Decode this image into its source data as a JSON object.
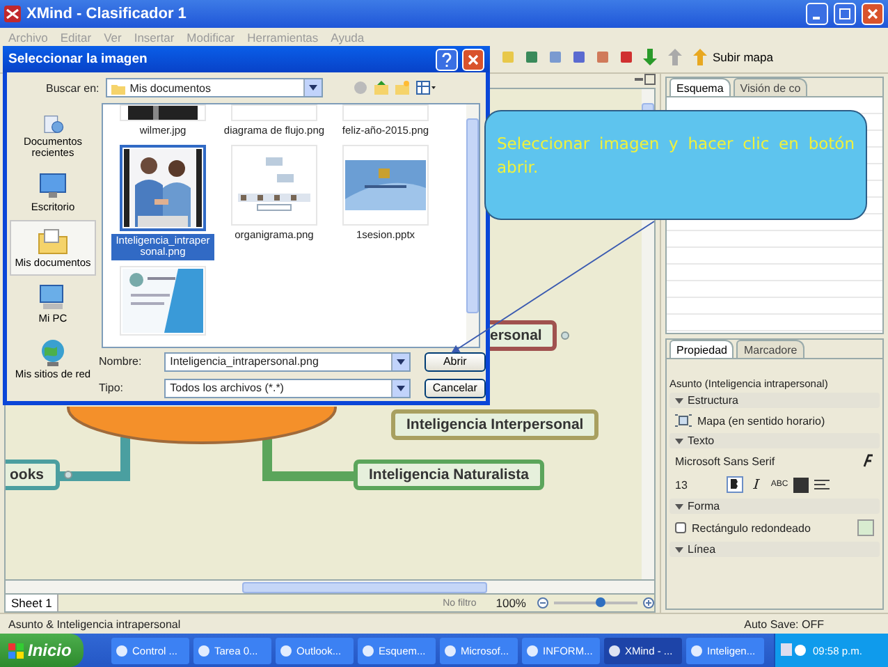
{
  "window": {
    "title": "XMind - Clasificador 1"
  },
  "menu": [
    "Archivo",
    "Editar",
    "Ver",
    "Insertar",
    "Modificar",
    "Herramientas",
    "Ayuda"
  ],
  "toolbar": {
    "button": "Subir mapa"
  },
  "map": {
    "nodes": [
      {
        "label": "ersonal",
        "kind": "topic",
        "color": "#a0524f"
      },
      {
        "label": "Inteligencia Interpersonal",
        "kind": "topic",
        "color": "#a8a060"
      },
      {
        "label": "ooks",
        "kind": "topic",
        "color": "#4a9fa0"
      },
      {
        "label": "Inteligencia Naturalista",
        "kind": "topic",
        "color": "#5ba55b"
      }
    ]
  },
  "editor_status": {
    "sheet": "Sheet 1",
    "filter": "No filtro",
    "zoom": "100%",
    "zoom_slider": {
      "level": 0.55
    }
  },
  "outline_panel": {
    "tabs": [
      {
        "label": "Esquema",
        "selected": true
      },
      {
        "label": "Visión de co",
        "selected": false
      }
    ]
  },
  "properties_panel": {
    "tabs": [
      {
        "label": "Propiedad",
        "selected": true
      },
      {
        "label": "Marcadore",
        "selected": false
      }
    ],
    "subject": "Asunto (Inteligencia intrapersonal)",
    "sections": [
      {
        "kind": "structure",
        "title": "Estructura",
        "value": "Mapa (en sentido horario)"
      },
      {
        "kind": "text",
        "title": "Texto",
        "font": "Microsoft Sans Serif",
        "size": "13",
        "bold": true,
        "strike": "ABC"
      },
      {
        "kind": "shape",
        "title": "Forma",
        "value": "Rectángulo redondeado",
        "checked": false
      },
      {
        "kind": "line",
        "title": "Línea"
      }
    ]
  },
  "status_bar": {
    "subject": "Asunto & Inteligencia intrapersonal",
    "autosave": "Auto Save: OFF"
  },
  "dialog": {
    "title": "Seleccionar la imagen",
    "look_in_label": "Buscar en:",
    "look_in": "Mis documentos",
    "places": [
      {
        "kind": "recent",
        "label": "Documentos recientes",
        "selected": false
      },
      {
        "kind": "desktop",
        "label": "Escritorio",
        "selected": false
      },
      {
        "kind": "documents",
        "label": "Mis documentos",
        "selected": true
      },
      {
        "kind": "computer",
        "label": "Mi PC",
        "selected": false
      },
      {
        "kind": "network",
        "label": "Mis sitios de red",
        "selected": false
      }
    ],
    "files": [
      {
        "kind": "dark",
        "name": "wilmer.jpg",
        "selected": false
      },
      {
        "kind": "blank",
        "name": "diagrama de flujo.png",
        "selected": false
      },
      {
        "kind": "blank",
        "name": "feliz-año-2015.png",
        "selected": false
      },
      {
        "name": "Inteligencia_intrapersonal.png",
        "selected": true
      },
      {
        "kind": "chart",
        "name": "organigrama.png",
        "selected": false
      },
      {
        "kind": "slide",
        "name": "1sesion.pptx",
        "selected": false
      },
      {
        "kind": "document",
        "selected": false
      }
    ],
    "name_label": "Nombre:",
    "name_value": "Inteligencia_intrapersonal.png",
    "type_label": "Tipo:",
    "type_value": "Todos los archivos (*.*)",
    "buttons": [
      "Abrir",
      "Cancelar"
    ]
  },
  "callout": {
    "text": "Seleccionar imagen y hacer clic en botón abrir."
  },
  "taskbar": {
    "start": "Inicio",
    "items": [
      {
        "label": "Control ...",
        "selected": false
      },
      {
        "label": "Tarea 0...",
        "selected": false
      },
      {
        "label": "Outlook...",
        "selected": false
      },
      {
        "label": "Esquem...",
        "selected": false
      },
      {
        "label": "Microsof...",
        "selected": false
      },
      {
        "label": "INFORM...",
        "selected": false
      },
      {
        "label": "XMind - ...",
        "selected": true
      },
      {
        "label": "Inteligen...",
        "selected": false
      }
    ],
    "clock": "09:58 p.m."
  }
}
